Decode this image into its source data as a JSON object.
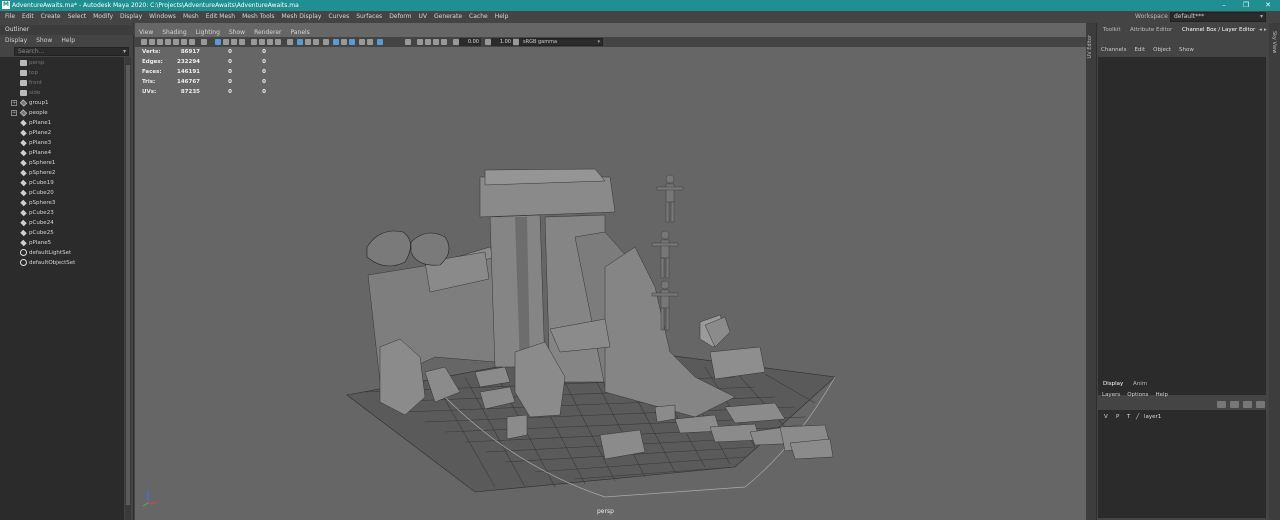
{
  "titlebar": {
    "title": "AdventureAwaits.ma* - Autodesk Maya 2020: C:\\Projects\\AdventureAwaits\\AdventureAwaits.ma",
    "app_icon": "M",
    "minimize": "–",
    "maximize": "❐",
    "close": "✕"
  },
  "menubar": {
    "items": [
      "File",
      "Edit",
      "Create",
      "Select",
      "Modify",
      "Display",
      "Windows",
      "Mesh",
      "Edit Mesh",
      "Mesh Tools",
      "Mesh Display",
      "Curves",
      "Surfaces",
      "Deform",
      "UV",
      "Generate",
      "Cache",
      "Help"
    ],
    "workspace_label": "Workspace :",
    "workspace_value": "default***"
  },
  "outliner": {
    "title": "Outliner",
    "menus": [
      "Display",
      "Show",
      "Help"
    ],
    "search_placeholder": "Search...",
    "items": [
      {
        "label": "persp",
        "kind": "cam",
        "dim": true
      },
      {
        "label": "top",
        "kind": "cam",
        "dim": true
      },
      {
        "label": "front",
        "kind": "cam",
        "dim": true
      },
      {
        "label": "side",
        "kind": "cam",
        "dim": true
      },
      {
        "label": "group1",
        "kind": "group",
        "expand": true
      },
      {
        "label": "people",
        "kind": "group",
        "expand": true
      },
      {
        "label": "pPlane1",
        "kind": "mesh"
      },
      {
        "label": "pPlane2",
        "kind": "mesh"
      },
      {
        "label": "pPlane3",
        "kind": "mesh"
      },
      {
        "label": "pPlane4",
        "kind": "mesh"
      },
      {
        "label": "pSphere1",
        "kind": "mesh"
      },
      {
        "label": "pSphere2",
        "kind": "mesh"
      },
      {
        "label": "pCube19",
        "kind": "mesh"
      },
      {
        "label": "pCube20",
        "kind": "mesh"
      },
      {
        "label": "pSphere3",
        "kind": "mesh"
      },
      {
        "label": "pCube23",
        "kind": "mesh"
      },
      {
        "label": "pCube24",
        "kind": "mesh"
      },
      {
        "label": "pCube25",
        "kind": "mesh"
      },
      {
        "label": "pPlane5",
        "kind": "mesh"
      },
      {
        "label": "defaultLightSet",
        "kind": "set"
      },
      {
        "label": "defaultObjectSet",
        "kind": "set"
      }
    ]
  },
  "viewport": {
    "menus": [
      "View",
      "Shading",
      "Lighting",
      "Show",
      "Renderer",
      "Panels"
    ],
    "exposure": "0.00",
    "gamma": "1.00",
    "color_space": "sRGB gamma",
    "camera": "persp",
    "hud": [
      {
        "k": "Verts:",
        "v1": "86917",
        "v2": "0",
        "v3": "0"
      },
      {
        "k": "Edges:",
        "v1": "232294",
        "v2": "0",
        "v3": "0"
      },
      {
        "k": "Faces:",
        "v1": "146191",
        "v2": "0",
        "v3": "0"
      },
      {
        "k": "Tris:",
        "v1": "146767",
        "v2": "0",
        "v3": "0"
      },
      {
        "k": "UVs:",
        "v1": "87235",
        "v2": "0",
        "v3": "0"
      }
    ]
  },
  "dock": {
    "uv_editor": "UV Editor",
    "side_label": "Sky View"
  },
  "right_panel": {
    "tabs": [
      "Toolkit",
      "Attribute Editor",
      "Channel Box / Layer Editor"
    ],
    "channel_menus": [
      "Channels",
      "Edit",
      "Object",
      "Show"
    ],
    "layer_tabs": [
      "Display",
      "Anim"
    ],
    "layer_menus": [
      "Layers",
      "Options",
      "Help"
    ],
    "layer": {
      "v": "V",
      "p": "P",
      "t": "T",
      "name": "layer1"
    }
  },
  "colors": {
    "titlebar": "#1f8f91",
    "viewport": "#666666",
    "panel": "#444444",
    "list": "#2b2b2b"
  }
}
